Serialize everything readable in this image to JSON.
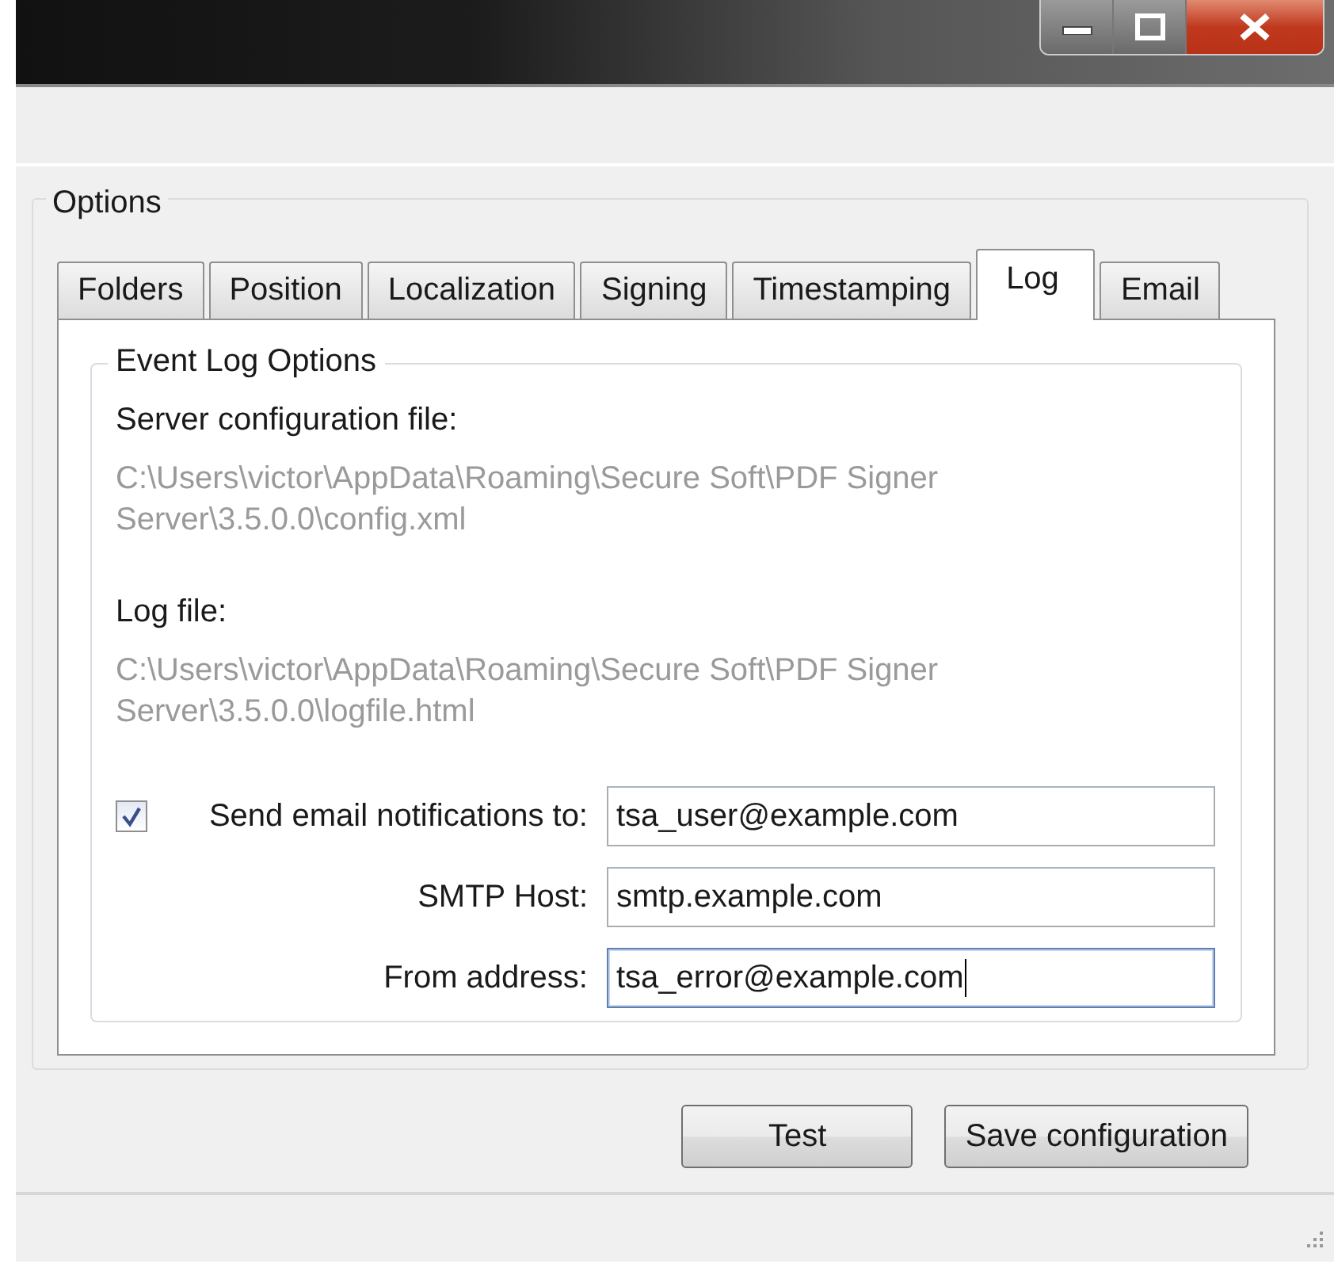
{
  "options_group": {
    "title": "Options"
  },
  "tabs": [
    {
      "label": "Folders",
      "selected": false
    },
    {
      "label": "Position",
      "selected": false
    },
    {
      "label": "Localization",
      "selected": false
    },
    {
      "label": "Signing",
      "selected": false
    },
    {
      "label": "Timestamping",
      "selected": false
    },
    {
      "label": "Log",
      "selected": true
    },
    {
      "label": "Email",
      "selected": false
    }
  ],
  "event_log_group": {
    "title": "Event Log Options",
    "paths": [
      {
        "label": "Server configuration file:",
        "lines": [
          "C:\\Users\\victor\\AppData\\Roaming\\Secure Soft\\PDF Signer",
          "Server\\3.5.0.0\\config.xml"
        ]
      },
      {
        "label": "Log file:",
        "lines": [
          "C:\\Users\\victor\\AppData\\Roaming\\Secure Soft\\PDF Signer",
          "Server\\3.5.0.0\\logfile.html"
        ]
      }
    ],
    "fields": [
      {
        "kind": "checkbox",
        "label": "Send email notifications to:",
        "checked": true,
        "value": "tsa_user@example.com",
        "focused": false
      },
      {
        "kind": "plain",
        "label": "SMTP Host:",
        "value": "smtp.example.com",
        "focused": false
      },
      {
        "kind": "plain",
        "label": "From address:",
        "value": "tsa_error@example.com",
        "focused": true
      }
    ]
  },
  "buttons": [
    {
      "label": "Test"
    },
    {
      "label": "Save configuration"
    }
  ]
}
